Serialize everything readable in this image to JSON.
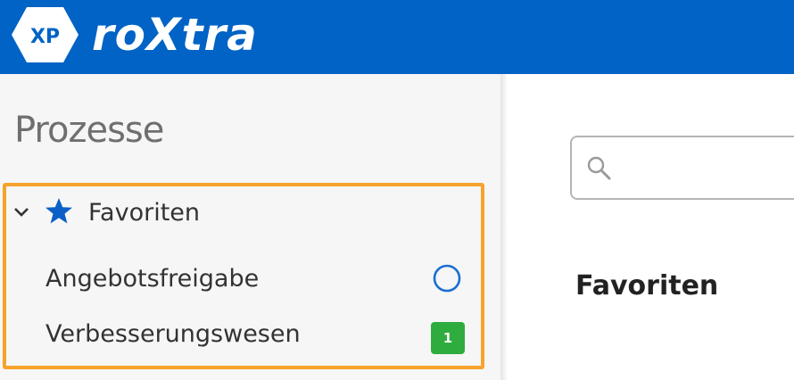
{
  "header": {
    "logo_badge": "XP",
    "app_name": "roXtra",
    "background_color": "#0063c5"
  },
  "sidebar": {
    "title": "Prozesse",
    "groups": [
      {
        "label": "Favoriten",
        "expanded": true,
        "icon": "star-icon",
        "highlight_color": "#f5a32c",
        "items": [
          {
            "label": "Angebotsfreigabe",
            "status": "circle-outline",
            "status_color": "#1a6fd1"
          },
          {
            "label": "Verbesserungswesen",
            "badge": "1",
            "badge_color": "#2eac3e"
          }
        ]
      }
    ]
  },
  "main": {
    "search": {
      "value": "",
      "placeholder": ""
    },
    "section_title": "Favoriten"
  }
}
